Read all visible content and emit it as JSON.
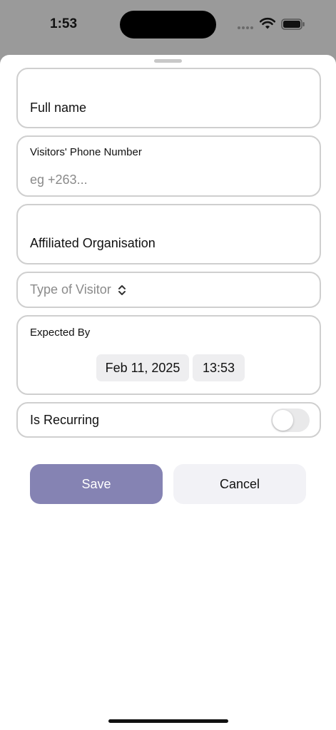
{
  "status_bar": {
    "time": "1:53",
    "icons": [
      "signal-dots-icon",
      "wifi-icon",
      "battery-icon"
    ]
  },
  "form": {
    "full_name_label": "Full name",
    "phone_label": "Visitors' Phone Number",
    "phone_placeholder": "eg +263...",
    "organisation_label": "Affiliated Organisation",
    "visitor_type_placeholder": "Type of Visitor",
    "expected_by_label": "Expected By",
    "expected_date": "Feb 11, 2025",
    "expected_time": "13:53",
    "recurring_label": "Is Recurring",
    "recurring_on": false
  },
  "actions": {
    "save_label": "Save",
    "cancel_label": "Cancel"
  },
  "colors": {
    "save_button": "#8583b3",
    "cancel_button": "#f2f2f6",
    "field_border": "#cfcfcf",
    "backdrop": "#9a9a9a"
  }
}
